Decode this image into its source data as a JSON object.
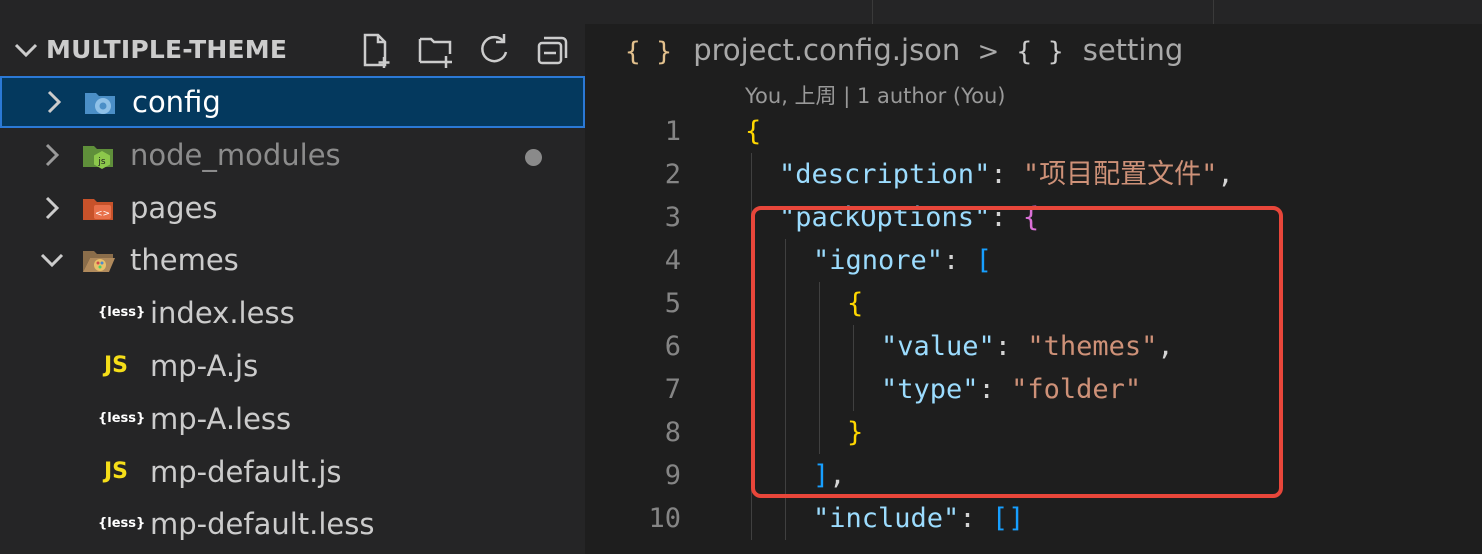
{
  "explorer": {
    "title": "MULTIPLE-THEME",
    "actions": [
      "new-file-icon",
      "new-folder-icon",
      "refresh-icon",
      "collapse-all-icon"
    ],
    "items": [
      {
        "label": "config",
        "type": "folder",
        "expanded": false,
        "icon": "config-folder-icon",
        "selected": true
      },
      {
        "label": "node_modules",
        "type": "folder",
        "expanded": false,
        "icon": "node-folder-icon",
        "dim": true
      },
      {
        "label": "pages",
        "type": "folder",
        "expanded": false,
        "icon": "pages-folder-icon"
      },
      {
        "label": "themes",
        "type": "folder",
        "expanded": true,
        "icon": "theme-folder-icon"
      },
      {
        "label": "index.less",
        "type": "file",
        "icon_text": "{less}"
      },
      {
        "label": "mp-A.js",
        "type": "file",
        "icon_text": "JS"
      },
      {
        "label": "mp-A.less",
        "type": "file",
        "icon_text": "{less}"
      },
      {
        "label": "mp-default.js",
        "type": "file",
        "icon_text": "JS"
      },
      {
        "label": "mp-default.less",
        "type": "file",
        "icon_text": "{less}"
      }
    ]
  },
  "editor": {
    "breadcrumb": {
      "brace": "{ }",
      "file": "project.config.json",
      "separator": ">",
      "symbol_brace": "{ }",
      "symbol": "setting"
    },
    "codelens": "You, 上周 | 1 author (You)",
    "lines": [
      {
        "n": "1",
        "parts": [
          [
            "b1",
            "{"
          ]
        ]
      },
      {
        "n": "2",
        "parts": [
          [
            "k",
            "\"description\""
          ],
          [
            "p",
            ": "
          ],
          [
            "s",
            "\"项目配置文件\""
          ],
          [
            "p",
            ","
          ]
        ]
      },
      {
        "n": "3",
        "parts": [
          [
            "k",
            "\"packOptions\""
          ],
          [
            "p",
            ": "
          ],
          [
            "b2",
            "{"
          ]
        ]
      },
      {
        "n": "4",
        "parts": [
          [
            "k",
            "\"ignore\""
          ],
          [
            "p",
            ": "
          ],
          [
            "b3",
            "["
          ]
        ]
      },
      {
        "n": "5",
        "parts": [
          [
            "b1",
            "{"
          ]
        ]
      },
      {
        "n": "6",
        "parts": [
          [
            "k",
            "\"value\""
          ],
          [
            "p",
            ": "
          ],
          [
            "s",
            "\"themes\""
          ],
          [
            "p",
            ","
          ]
        ]
      },
      {
        "n": "7",
        "parts": [
          [
            "k",
            "\"type\""
          ],
          [
            "p",
            ": "
          ],
          [
            "s",
            "\"folder\""
          ]
        ]
      },
      {
        "n": "8",
        "parts": [
          [
            "b1",
            "}"
          ]
        ]
      },
      {
        "n": "9",
        "parts": [
          [
            "b3",
            "]"
          ],
          [
            "p",
            ","
          ]
        ]
      },
      {
        "n": "10",
        "parts": [
          [
            "k",
            "\"include\""
          ],
          [
            "p",
            ": "
          ],
          [
            "b3",
            "[]"
          ]
        ]
      }
    ],
    "indent": [
      0,
      1,
      1,
      2,
      3,
      4,
      4,
      3,
      2,
      2
    ]
  },
  "colors": {
    "accent": "#2b79d6",
    "highlight_box": "#e8463a",
    "string": "#ce9178",
    "key": "#9cdcfe"
  }
}
